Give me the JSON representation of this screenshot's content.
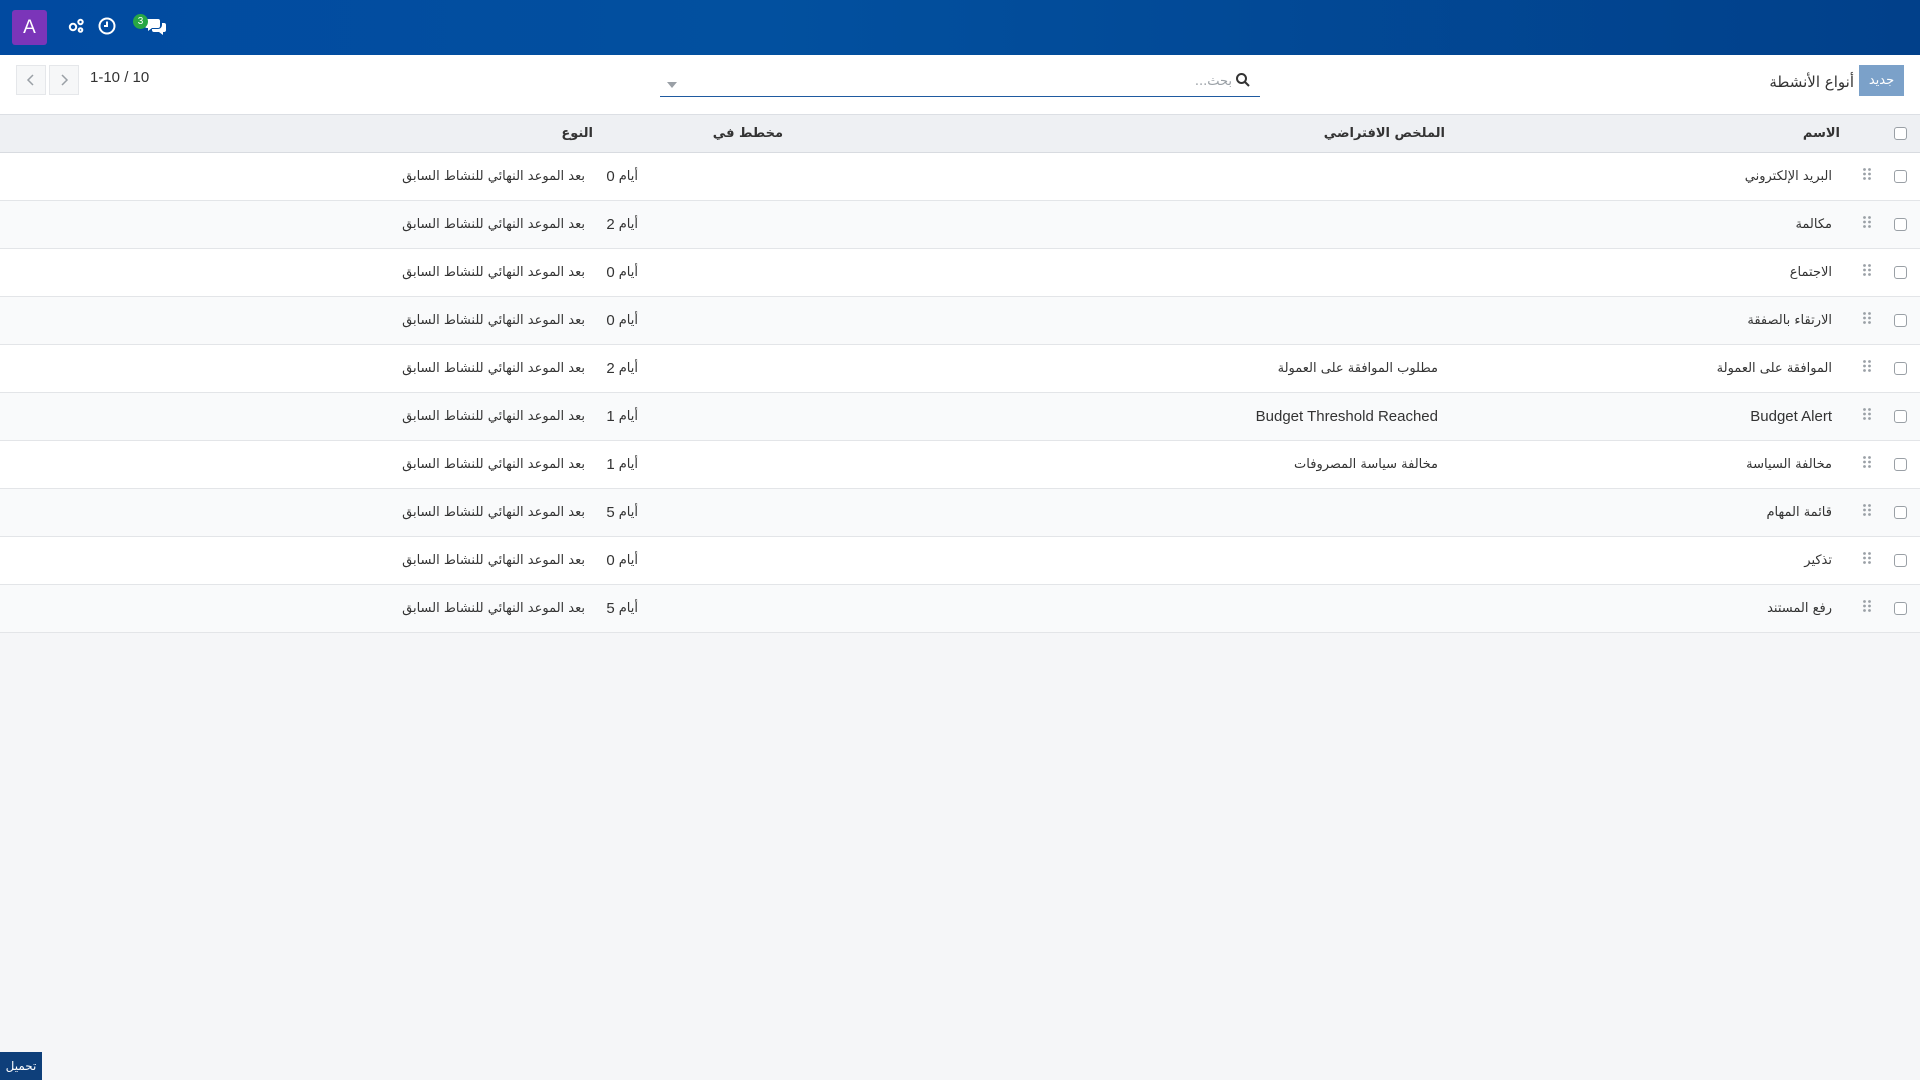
{
  "navbar": {
    "avatar_letter": "A",
    "chat_badge": "3"
  },
  "control_panel": {
    "breadcrumb": "أنواع الأنشطة",
    "new_button": "جديد",
    "search_placeholder": "بحث...",
    "pager_value": "1-10 / 10"
  },
  "table": {
    "headers": {
      "name": "الاسم",
      "summary": "الملخص الافتراضي",
      "planned_in": "مخطط في",
      "type": "النوع"
    },
    "rows": [
      {
        "name": "البريد الإلكتروني",
        "summary": "",
        "days": "0",
        "unit": "أيام",
        "type": "بعد الموعد النهائي للنشاط السابق"
      },
      {
        "name": "مكالمة",
        "summary": "",
        "days": "2",
        "unit": "أيام",
        "type": "بعد الموعد النهائي للنشاط السابق"
      },
      {
        "name": "الاجتماع",
        "summary": "",
        "days": "0",
        "unit": "أيام",
        "type": "بعد الموعد النهائي للنشاط السابق"
      },
      {
        "name": "الارتقاء بالصفقة",
        "summary": "",
        "days": "0",
        "unit": "أيام",
        "type": "بعد الموعد النهائي للنشاط السابق"
      },
      {
        "name": "الموافقة على العمولة",
        "summary": "مطلوب الموافقة على العمولة",
        "days": "2",
        "unit": "أيام",
        "type": "بعد الموعد النهائي للنشاط السابق"
      },
      {
        "name": "Budget Alert",
        "summary": "Budget Threshold Reached",
        "days": "1",
        "unit": "أيام",
        "type": "بعد الموعد النهائي للنشاط السابق",
        "latin": true
      },
      {
        "name": "مخالفة السياسة",
        "summary": "مخالفة سياسة المصروفات",
        "days": "1",
        "unit": "أيام",
        "type": "بعد الموعد النهائي للنشاط السابق"
      },
      {
        "name": "قائمة المهام",
        "summary": "",
        "days": "5",
        "unit": "أيام",
        "type": "بعد الموعد النهائي للنشاط السابق"
      },
      {
        "name": "تذكير",
        "summary": "",
        "days": "0",
        "unit": "أيام",
        "type": "بعد الموعد النهائي للنشاط السابق"
      },
      {
        "name": "رفع المستند",
        "summary": "",
        "days": "5",
        "unit": "أيام",
        "type": "بعد الموعد النهائي للنشاط السابق"
      }
    ]
  },
  "footer": {
    "download_label": "تحميل"
  },
  "colors": {
    "navbar": "#014aa0",
    "avatar": "#7b35b9",
    "new_button": "#7ba1c9",
    "badge": "#28a745"
  }
}
